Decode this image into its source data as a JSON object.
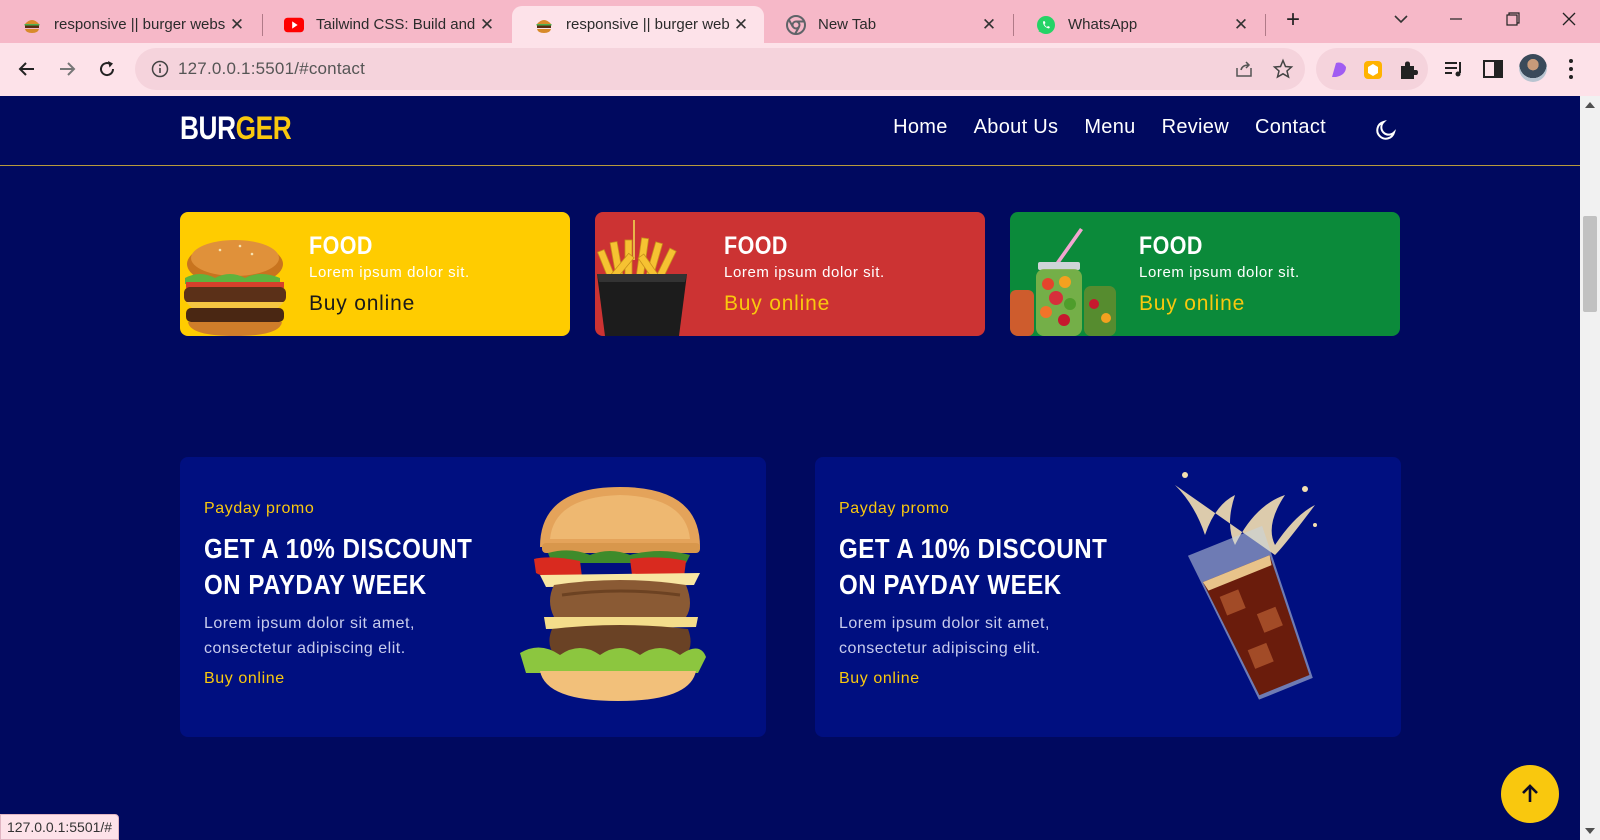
{
  "browser": {
    "tabs": [
      {
        "title": "responsive || burger webs",
        "icon": "burger-favicon-icon",
        "active": false
      },
      {
        "title": "Tailwind CSS: Build and De",
        "icon": "youtube-icon",
        "active": false
      },
      {
        "title": "responsive || burger webs",
        "icon": "burger-favicon-icon",
        "active": true
      },
      {
        "title": "New Tab",
        "icon": "chrome-icon",
        "active": false
      },
      {
        "title": "WhatsApp",
        "icon": "whatsapp-icon",
        "active": false
      }
    ],
    "url": "127.0.0.1:5501/#contact",
    "status_url": "127.0.0.1:5501/#"
  },
  "site": {
    "logo_part1": "BUR",
    "logo_part2": "GER",
    "nav": [
      "Home",
      "About Us",
      "Menu",
      "Review",
      "Contact"
    ]
  },
  "food_cards": [
    {
      "title": "FOOD",
      "subtitle": "Lorem ipsum dolor sit.",
      "cta": "Buy online",
      "bg": "#ffcc00",
      "cta_color": "#1a1a1a",
      "image": "burger"
    },
    {
      "title": "FOOD",
      "subtitle": "Lorem ipsum dolor sit.",
      "cta": "Buy online",
      "bg": "#cc3333",
      "cta_color": "#f9c80e",
      "image": "fries"
    },
    {
      "title": "FOOD",
      "subtitle": "Lorem ipsum dolor sit.",
      "cta": "Buy online",
      "bg": "#0b8a3a",
      "cta_color": "#f9c80e",
      "image": "fruit-jars"
    }
  ],
  "promos": [
    {
      "eyebrow": "Payday promo",
      "heading": "GET A 10% DISCOUNT ON PAYDAY WEEK",
      "description": "Lorem ipsum dolor sit amet, consectetur adipiscing elit.",
      "cta": "Buy online",
      "image": "burger"
    },
    {
      "eyebrow": "Payday promo",
      "heading": "GET A 10% DISCOUNT ON PAYDAY WEEK",
      "description": "Lorem ipsum dolor sit amet, consectetur adipiscing elit.",
      "cta": "Buy online",
      "image": "cola-glass"
    }
  ],
  "colors": {
    "page_bg": "#00095f",
    "accent": "#f9c80e",
    "card_bg": "#000f80"
  }
}
